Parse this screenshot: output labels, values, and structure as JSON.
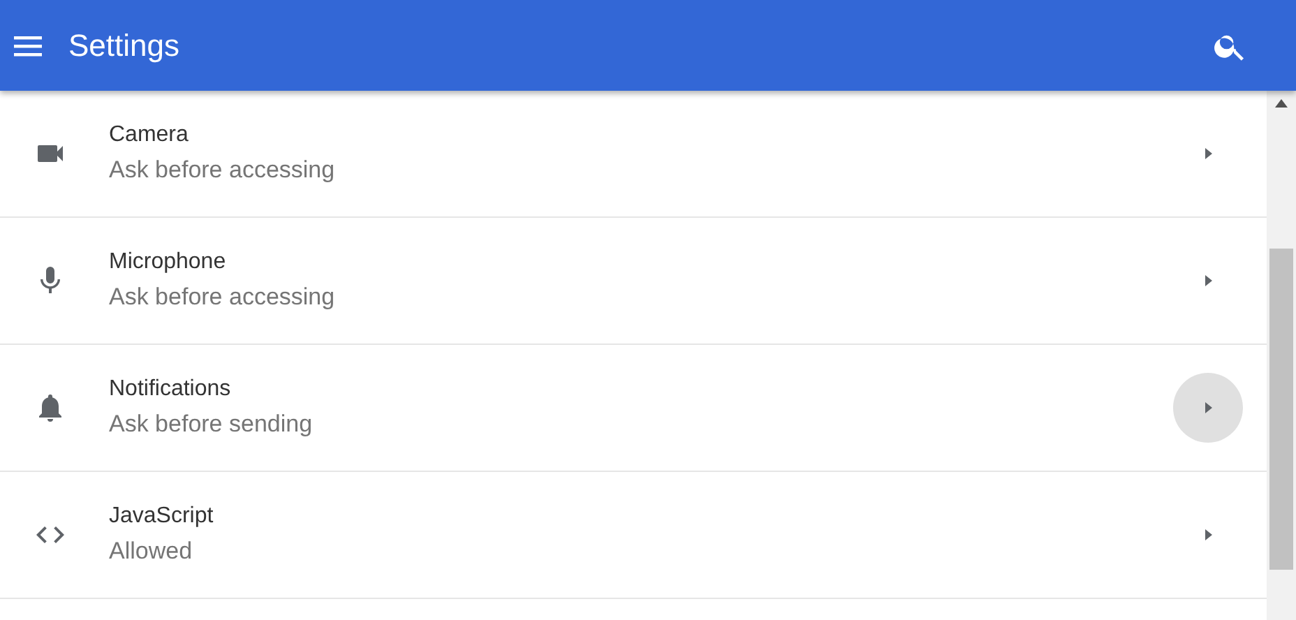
{
  "app_bar": {
    "title": "Settings"
  },
  "rows": [
    {
      "kind": "camera",
      "title": "Camera",
      "subtitle": "Ask before accessing",
      "hovered": false
    },
    {
      "kind": "microphone",
      "title": "Microphone",
      "subtitle": "Ask before accessing",
      "hovered": false
    },
    {
      "kind": "notifications",
      "title": "Notifications",
      "subtitle": "Ask before sending",
      "hovered": true
    },
    {
      "kind": "javascript",
      "title": "JavaScript",
      "subtitle": "Allowed",
      "hovered": false
    }
  ]
}
